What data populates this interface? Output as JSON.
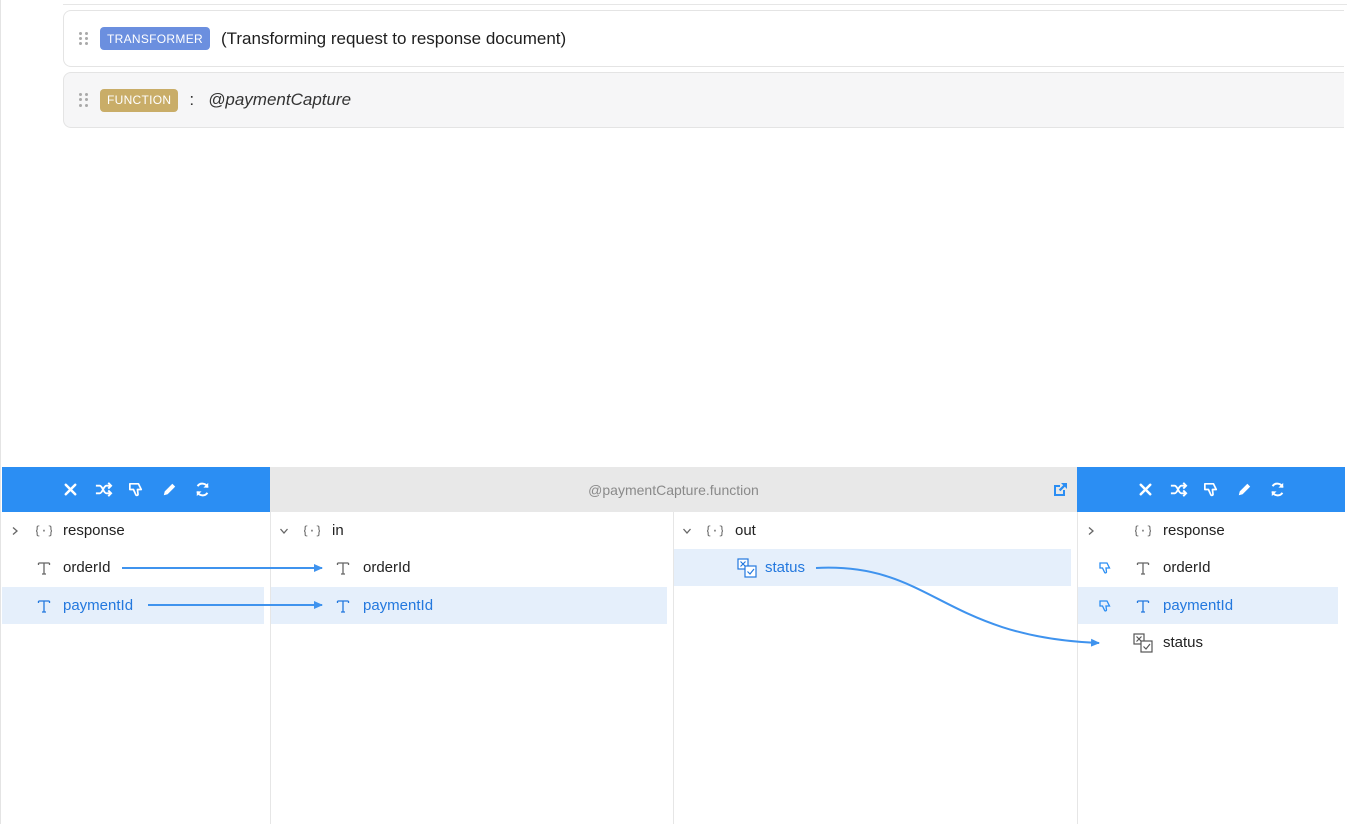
{
  "steps": {
    "transformer": {
      "badge": "TRANSFORMER",
      "text": "(Transforming request to response document)"
    },
    "function": {
      "badge": "FUNCTION",
      "colon": ":",
      "name": "@paymentCapture"
    }
  },
  "mapper": {
    "function_title": "@paymentCapture.function",
    "toolbar_icons": [
      "close-icon",
      "shuffle-icon",
      "thumb-down-icon",
      "pencil-icon",
      "refresh-icon"
    ],
    "source": {
      "items": [
        {
          "label": "response",
          "type": "object",
          "expanded": false
        },
        {
          "label": "orderId",
          "type": "text"
        },
        {
          "label": "paymentId",
          "type": "text",
          "selected": true
        }
      ]
    },
    "function_in": {
      "label": "in",
      "items": [
        {
          "label": "orderId",
          "type": "text"
        },
        {
          "label": "paymentId",
          "type": "text",
          "selected": true
        }
      ]
    },
    "function_out": {
      "label": "out",
      "items": [
        {
          "label": "status",
          "type": "boolean",
          "selected": true
        }
      ]
    },
    "target": {
      "items": [
        {
          "label": "response",
          "type": "object",
          "expanded": false
        },
        {
          "label": "orderId",
          "type": "text",
          "dropped": true
        },
        {
          "label": "paymentId",
          "type": "text",
          "dropped": true,
          "selected": true
        },
        {
          "label": "status",
          "type": "boolean"
        }
      ]
    }
  },
  "colors": {
    "accent": "#2b8ef3",
    "link": "#3f93ee",
    "selected_row": "#e5effb",
    "transformer_badge": "#6b8fdf",
    "function_badge": "#c9ad68"
  }
}
